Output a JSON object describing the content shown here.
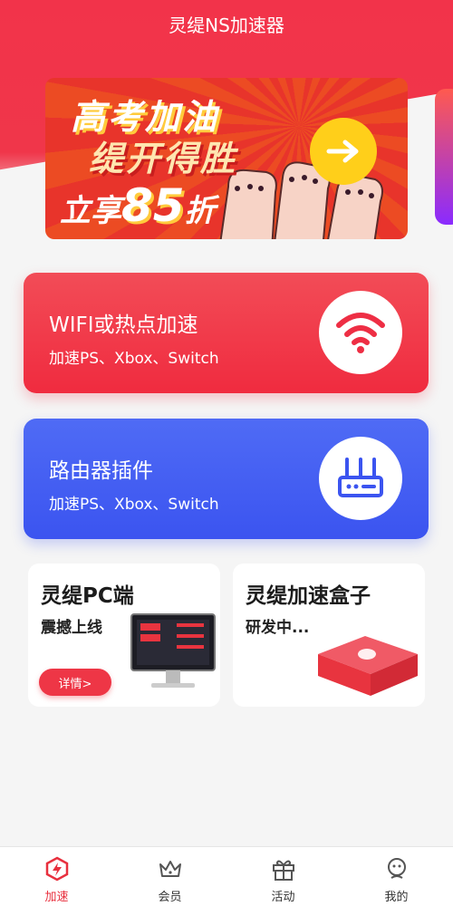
{
  "header": {
    "title": "灵缇NS加速器"
  },
  "banner": {
    "line1": "高考加油",
    "line2": "缇开得胜",
    "line3_prefix": "立享",
    "line3_number": "85",
    "line3_suffix": "折"
  },
  "cards": [
    {
      "title": "WIFI或热点加速",
      "subtitle": "加速PS、Xbox、Switch",
      "icon": "wifi-icon"
    },
    {
      "title": "路由器插件",
      "subtitle": "加速PS、Xbox、Switch",
      "icon": "router-icon"
    }
  ],
  "mini_cards": {
    "pc": {
      "title": "灵缇PC端",
      "subtitle": "震撼上线",
      "button": "详情>"
    },
    "box": {
      "title": "灵缇加速盒子",
      "subtitle": "研发中..."
    }
  },
  "bottom_nav": [
    {
      "label": "加速",
      "icon": "lightning-shield-icon",
      "active": true
    },
    {
      "label": "会员",
      "icon": "crown-icon",
      "active": false
    },
    {
      "label": "活动",
      "icon": "gift-icon",
      "active": false
    },
    {
      "label": "我的",
      "icon": "robot-face-icon",
      "active": false
    }
  ],
  "colors": {
    "brand_red": "#f0364a",
    "router_blue": "#3b54f0",
    "nav_active": "#e8303e"
  }
}
